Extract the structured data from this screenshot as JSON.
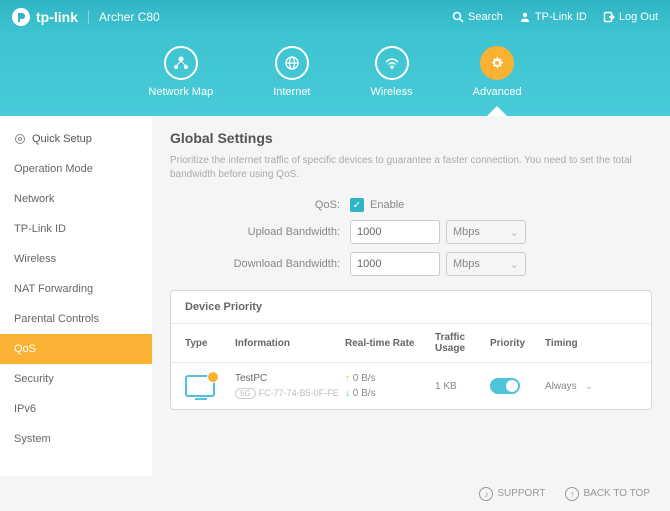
{
  "header": {
    "brand": "tp-link",
    "model": "Archer C80",
    "search": "Search",
    "tplink_id": "TP-Link ID",
    "logout": "Log Out"
  },
  "topnav": {
    "items": [
      {
        "label": "Network Map"
      },
      {
        "label": "Internet"
      },
      {
        "label": "Wireless"
      },
      {
        "label": "Advanced"
      }
    ]
  },
  "sidebar": {
    "items": [
      {
        "label": "Quick Setup"
      },
      {
        "label": "Operation Mode"
      },
      {
        "label": "Network"
      },
      {
        "label": "TP-Link ID"
      },
      {
        "label": "Wireless"
      },
      {
        "label": "NAT Forwarding"
      },
      {
        "label": "Parental Controls"
      },
      {
        "label": "QoS"
      },
      {
        "label": "Security"
      },
      {
        "label": "IPv6"
      },
      {
        "label": "System"
      }
    ]
  },
  "global": {
    "title": "Global Settings",
    "desc": "Prioritize the internet traffic of specific devices to guarantee a faster connection. You need to set the total bandwidth before using QoS.",
    "qos_label": "QoS:",
    "enable": "Enable",
    "upload_label": "Upload Bandwidth:",
    "upload_value": "1000",
    "download_label": "Download Bandwidth:",
    "download_value": "1000",
    "unit": "Mbps"
  },
  "panel": {
    "title": "Device Priority",
    "cols": {
      "type": "Type",
      "info": "Information",
      "rate": "Real-time Rate",
      "usage": "Traffic Usage",
      "priority": "Priority",
      "timing": "Timing"
    },
    "row": {
      "name": "TestPC",
      "mac_prefix": "5G",
      "mac": "FC-77-74-B5-0F-FE",
      "up": "0 B/s",
      "down": "0 B/s",
      "usage": "1 KB",
      "timing": "Always"
    }
  },
  "footer": {
    "support": "SUPPORT",
    "backtop": "BACK TO TOP"
  }
}
